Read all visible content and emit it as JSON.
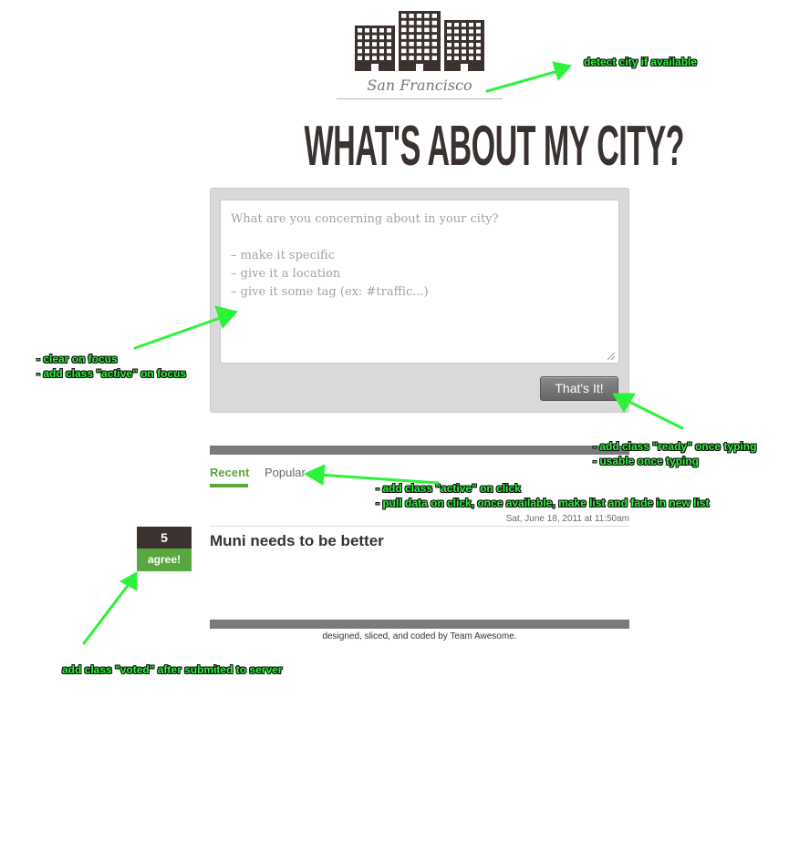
{
  "header": {
    "city": "San Francisco",
    "headline": "WHAT'S ABOUT MY CITY?"
  },
  "compose": {
    "placeholder_lines": [
      "What are you concerning about in your city?",
      "– make it specific",
      "– give it a location",
      "– give it some tag (ex: #traffic...)"
    ],
    "submit_label": "That's It!"
  },
  "tabs": [
    {
      "label": "Recent",
      "active": true
    },
    {
      "label": "Popular",
      "active": false
    }
  ],
  "post": {
    "date": "Sat, June 18, 2011 at 11:50am",
    "votes": "5",
    "agree_label": "agree!",
    "title": "Muni needs to be better"
  },
  "footer": {
    "credit": "designed, sliced, and coded by Team Awesome."
  },
  "annotations": {
    "city": "detect city if available",
    "textarea": [
      "- clear on focus",
      "- add class \"active\" on focus"
    ],
    "submit": [
      "- add class \"ready\" once typing",
      "- usable once typing"
    ],
    "tabs": [
      "- add class \"active\" on click",
      "- pull data on click, once available, make list and fade in new list"
    ],
    "vote": "add class \"voted\" after submited to server"
  },
  "colors": {
    "accent_green": "#58a83f",
    "dark": "#3b3230",
    "annotation_green": "#2df23a"
  },
  "icons": [
    "buildings-logo-icon",
    "resize-grip-icon",
    "arrow-icon"
  ]
}
